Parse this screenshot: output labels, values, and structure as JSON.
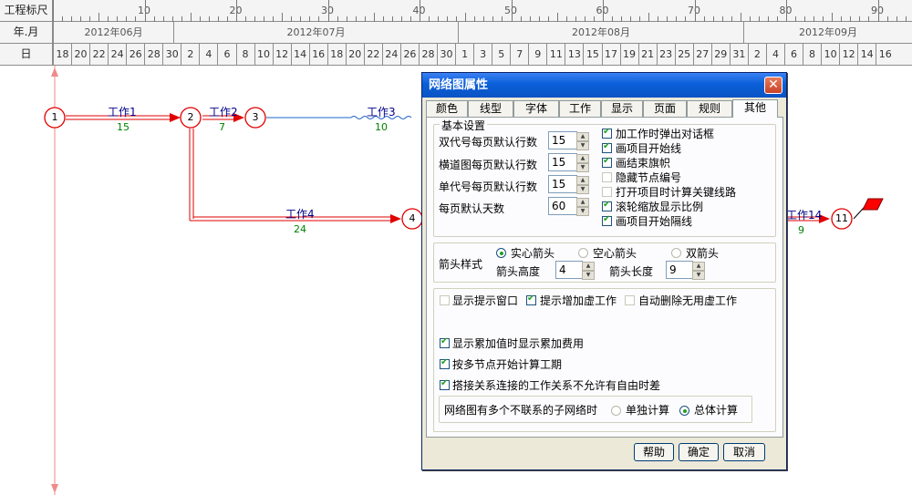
{
  "ruler": {
    "label_scale": "工程标尺",
    "label_month": "年.月",
    "label_day": "日",
    "scale_numbers": [
      "10",
      "20",
      "30",
      "40",
      "50",
      "60",
      "70",
      "80",
      "90"
    ],
    "months": [
      "2012年06月",
      "2012年07月",
      "2012年08月",
      "2012年09月"
    ],
    "days": [
      "18",
      "20",
      "22",
      "24",
      "26",
      "28",
      "30",
      "2",
      "4",
      "6",
      "8",
      "10",
      "12",
      "14",
      "16",
      "18",
      "20",
      "22",
      "24",
      "26",
      "28",
      "30",
      "1",
      "3",
      "5",
      "7",
      "9",
      "11",
      "13",
      "15",
      "17",
      "19",
      "21",
      "23",
      "25",
      "27",
      "29",
      "31",
      "2",
      "4",
      "6",
      "8",
      "10",
      "12",
      "14",
      "16"
    ]
  },
  "network": {
    "nodes": [
      "1",
      "2",
      "3",
      "4",
      "11"
    ],
    "works": [
      {
        "name": "工作1",
        "dur": "15"
      },
      {
        "name": "工作2",
        "dur": "7"
      },
      {
        "name": "工作3",
        "dur": "10"
      },
      {
        "name": "工作4",
        "dur": "24"
      },
      {
        "name": "工作14",
        "dur": "9"
      }
    ]
  },
  "dialog": {
    "title": "网络图属性",
    "close": "✕",
    "tabs": [
      "颜色",
      "线型",
      "字体",
      "工作",
      "显示",
      "页面",
      "规则",
      "其他"
    ],
    "active_tab": "其他",
    "basic": {
      "title": "基本设置",
      "fields": [
        {
          "label": "双代号每页默认行数",
          "value": "15"
        },
        {
          "label": "横道图每页默认行数",
          "value": "15"
        },
        {
          "label": "单代号每页默认行数",
          "value": "15"
        },
        {
          "label": "每页默认天数",
          "value": "60"
        }
      ],
      "checks": [
        {
          "label": "加工作时弹出对话框",
          "checked": true
        },
        {
          "label": "画项目开始线",
          "checked": true
        },
        {
          "label": "画结束旗帜",
          "checked": true
        },
        {
          "label": "隐藏节点编号",
          "checked": false
        },
        {
          "label": "打开项目时计算关键线路",
          "checked": false
        },
        {
          "label": "滚轮缩放显示比例",
          "checked": true
        },
        {
          "label": "画项目开始隔线",
          "checked": true
        }
      ]
    },
    "arrow": {
      "style_label": "箭头样式",
      "solid": "实心箭头",
      "hollow": "空心箭头",
      "double": "双箭头",
      "height_label": "箭头高度",
      "height_value": "4",
      "length_label": "箭头长度",
      "length_value": "9"
    },
    "options": {
      "show_tip": "显示提示窗口",
      "tip_dummy": "提示增加虚工作",
      "auto_delete": "自动删除无用虚工作",
      "show_cumulative": "显示累加值时显示累加费用",
      "multi_node": "按多节点开始计算工期",
      "no_free_float": "搭接关系连接的工作关系不允许有自由时差",
      "subnet_label": "网络图有多个不联系的子网络时",
      "calc_separate": "单独计算",
      "calc_total": "总体计算"
    },
    "buttons": {
      "help": "帮助",
      "ok": "确定",
      "cancel": "取消"
    }
  }
}
